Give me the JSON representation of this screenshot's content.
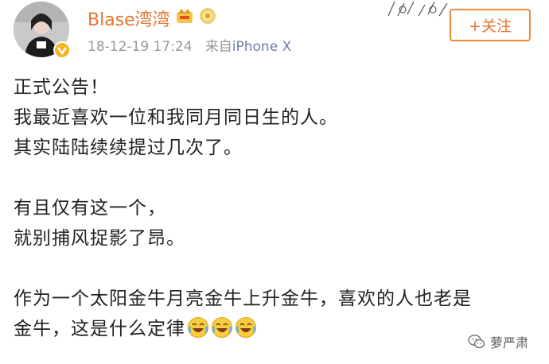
{
  "post": {
    "username": "Blase湾湾",
    "timestamp": "18-12-19 17:24",
    "source_prefix": "来自",
    "source_device": "iPhone X",
    "follow_label": "+关注",
    "lines": [
      "正式公告！",
      "我最近喜欢一位和我同月同日生的人。",
      "其实陆陆续续提过几次了。",
      "",
      "有且仅有这一个，",
      "就别捕风捉影了昂。",
      "",
      "作为一个太阳金牛月亮金牛上升金牛，喜欢的人也老是",
      "金牛，这是什么定律"
    ],
    "trailing_emoji": [
      "laugh-cry-emoji",
      "laugh-cry-emoji",
      "laugh-cry-emoji"
    ]
  },
  "watermark": {
    "name": "萝严肃",
    "icon": "wechat-icon"
  },
  "colors": {
    "username": "#e8732d",
    "meta": "#9a9a9a",
    "follow_border": "#f08b3a",
    "text": "#222222",
    "vip_badge": "#f6b420"
  }
}
